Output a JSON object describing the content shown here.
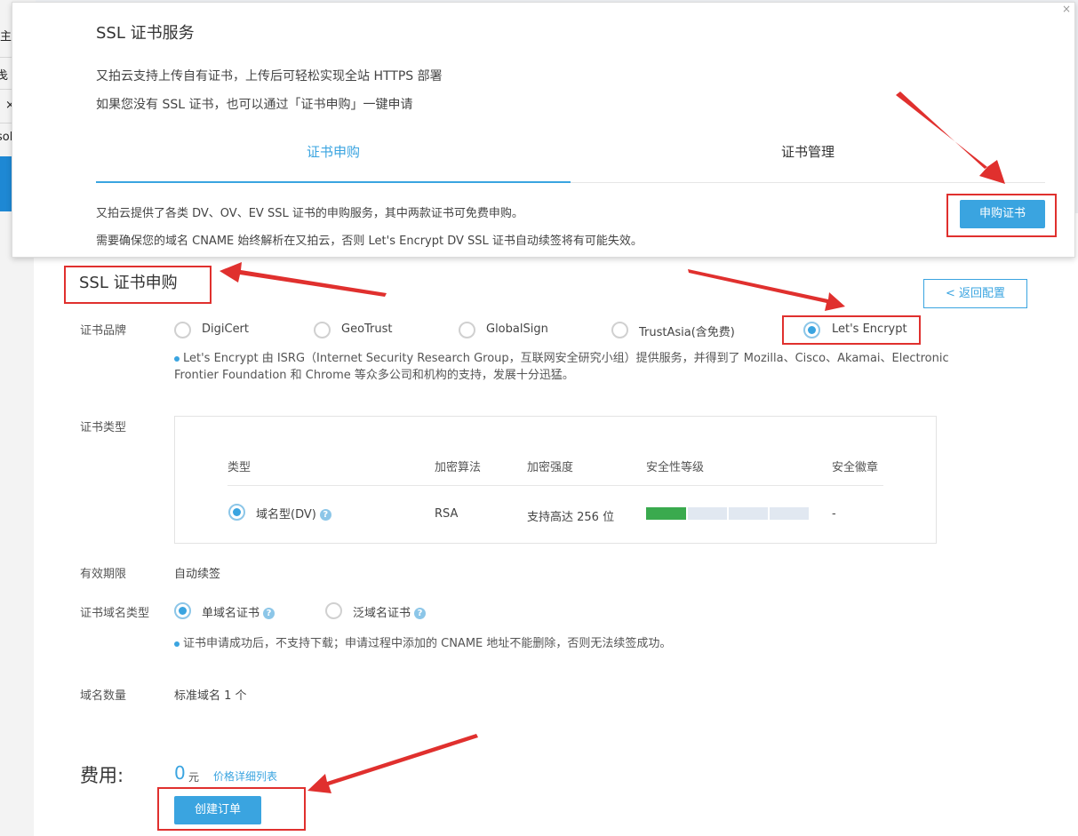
{
  "background": {
    "fragments": [
      "主",
      "戋",
      "×",
      "sol"
    ],
    "corner_close": "×"
  },
  "panel": {
    "title": "SSL 证书服务",
    "desc1": "又拍云支持上传自有证书，上传后可轻松实现全站 HTTPS 部署",
    "desc2": "如果您没有 SSL 证书，也可以通过「证书申购」一键申请",
    "tabs": [
      {
        "label": "证书申购",
        "active": true
      },
      {
        "label": "证书管理",
        "active": false
      }
    ],
    "info1": "又拍云提供了各类 DV、OV、EV SSL 证书的申购服务，其中两款证书可免费申购。",
    "info2": "需要确保您的域名 CNAME 始终解析在又拍云，否则 Let's Encrypt DV SSL 证书自动续签将有可能失效。",
    "buy_button": "申购证书"
  },
  "section": {
    "title": "SSL 证书申购",
    "back_button": "< 返回配置"
  },
  "brand": {
    "label": "证书品牌",
    "options": [
      {
        "label": "DigiCert",
        "selected": false
      },
      {
        "label": "GeoTrust",
        "selected": false
      },
      {
        "label": "GlobalSign",
        "selected": false
      },
      {
        "label": "TrustAsia(含免费)",
        "selected": false
      },
      {
        "label": "Let's Encrypt",
        "selected": true
      }
    ],
    "note_line1": "Let's Encrypt 由 ISRG（Internet Security Research Group，互联网安全研究小组）提供服务，并得到了 Mozilla、Cisco、Akamai、Electronic",
    "note_line2": "Frontier Foundation 和 Chrome 等众多公司和机构的支持，发展十分迅猛。"
  },
  "cert_type": {
    "label": "证书类型",
    "headers": [
      "类型",
      "加密算法",
      "加密强度",
      "安全性等级",
      "安全徽章"
    ],
    "row": {
      "type": "域名型(DV)",
      "algorithm": "RSA",
      "strength": "支持高达 256 位",
      "security_level_fraction": 0.25,
      "badge": "-"
    }
  },
  "validity": {
    "label": "有效期限",
    "value": "自动续签"
  },
  "domain_type": {
    "label": "证书域名类型",
    "options": [
      {
        "label": "单域名证书",
        "selected": true
      },
      {
        "label": "泛域名证书",
        "selected": false
      }
    ],
    "note": "证书申请成功后，不支持下载；申请过程中添加的 CNAME 地址不能删除，否则无法续签成功。"
  },
  "domain_count": {
    "label": "域名数量",
    "value": "标准域名 1 个"
  },
  "fee": {
    "label": "费用:",
    "amount": "0",
    "unit": "元",
    "link": "价格详细列表",
    "order_button": "创建订单"
  },
  "colors": {
    "accent": "#3aa4e0",
    "annotation": "#e0302e",
    "security_fill": "#3aaa4e"
  }
}
